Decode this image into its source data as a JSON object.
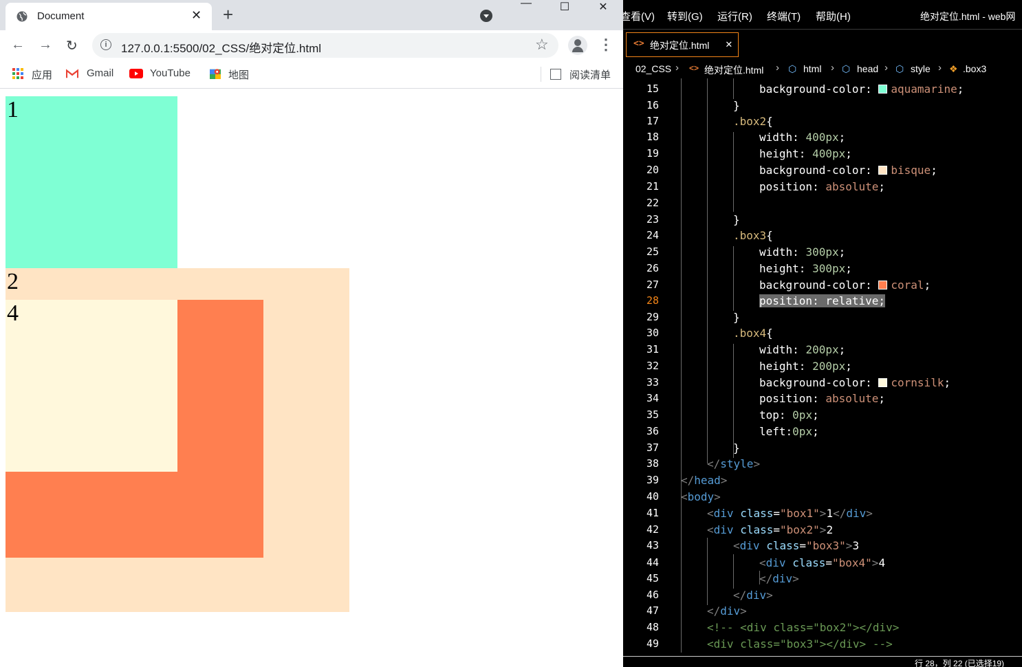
{
  "browser": {
    "tab_title": "Document",
    "tab_close": "✕",
    "new_tab": "+",
    "url": "127.0.0.1:5500/02_CSS/绝对定位.html",
    "bookmarks": {
      "apps": "应用",
      "gmail": "Gmail",
      "youtube": "YouTube",
      "maps": "地图",
      "reading_list": "阅读清单"
    }
  },
  "page": {
    "box1_text": "1",
    "box2_text": "2",
    "box4_text": "4",
    "colors": {
      "box1": "#7fffd4",
      "box2": "#ffe4c4",
      "box3": "#ff7f50",
      "box4": "#fff8dc"
    }
  },
  "editor": {
    "menu": [
      "查看(V)",
      "转到(G)",
      "运行(R)",
      "终端(T)",
      "帮助(H)"
    ],
    "window_title": "绝对定位.html - web网",
    "tab_name": "绝对定位.html",
    "breadcrumbs": [
      "02_CSS",
      "绝对定位.html",
      "html",
      "head",
      "style",
      ".box3"
    ],
    "current_line": 28,
    "status": "行 28，列 22 (已选择19)",
    "line_numbers": [
      15,
      16,
      17,
      18,
      19,
      20,
      21,
      22,
      23,
      24,
      25,
      26,
      27,
      28,
      29,
      30,
      31,
      32,
      33,
      34,
      35,
      36,
      37,
      38,
      39,
      40,
      41,
      42,
      43,
      44,
      45,
      46,
      47,
      48,
      49
    ]
  }
}
